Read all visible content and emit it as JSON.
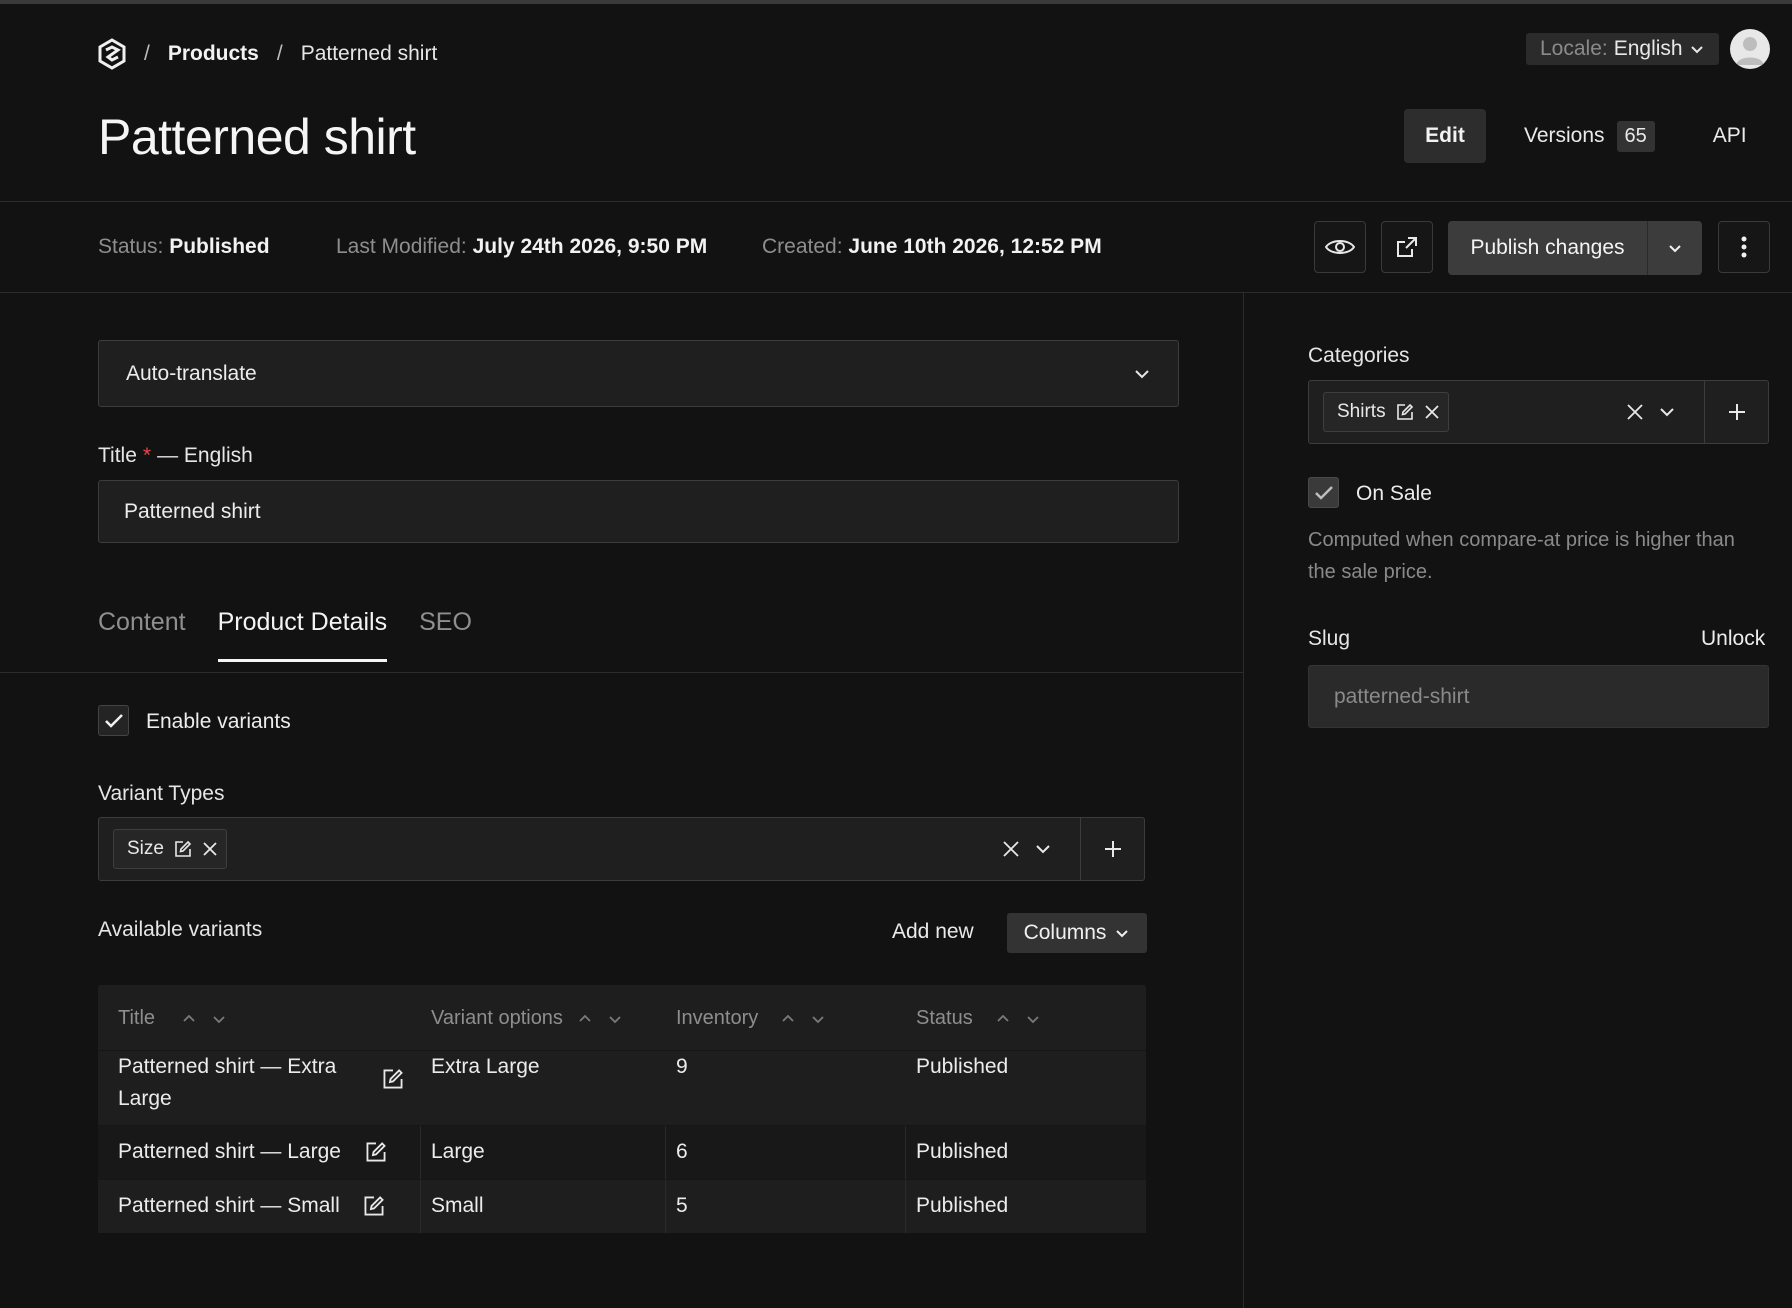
{
  "breadcrumb": {
    "separator": "/",
    "parent": "Products",
    "current": "Patterned shirt"
  },
  "locale": {
    "label": "Locale:",
    "value": "English"
  },
  "page": {
    "title": "Patterned shirt"
  },
  "header_tabs": {
    "edit": "Edit",
    "versions": "Versions",
    "versions_count": "65",
    "api": "API"
  },
  "meta": {
    "status_label": "Status:",
    "status_value": "Published",
    "modified_label": "Last Modified:",
    "modified_value": "July 24th 2026, 9:50 PM",
    "created_label": "Created:",
    "created_value": "June 10th 2026, 12:52 PM"
  },
  "actions": {
    "publish": "Publish changes"
  },
  "form": {
    "auto_translate": "Auto-translate",
    "title_label": "Title",
    "required_mark": "*",
    "title_lang": "— English",
    "title_value": "Patterned shirt"
  },
  "tabs": [
    "Content",
    "Product Details",
    "SEO"
  ],
  "variants": {
    "enable_label": "Enable variants",
    "enabled": true,
    "types_label": "Variant Types",
    "type_chips": [
      "Size"
    ],
    "available_label": "Available variants",
    "add_new": "Add new",
    "columns": "Columns",
    "headers": [
      "Title",
      "Variant options",
      "Inventory",
      "Status"
    ],
    "rows": [
      {
        "title": "Patterned shirt — Extra Large",
        "option": "Extra Large",
        "inventory": "9",
        "status": "Published"
      },
      {
        "title": "Patterned shirt — Large",
        "option": "Large",
        "inventory": "6",
        "status": "Published"
      },
      {
        "title": "Patterned shirt — Small",
        "option": "Small",
        "inventory": "5",
        "status": "Published"
      }
    ]
  },
  "sidebar": {
    "categories_label": "Categories",
    "category_chips": [
      "Shirts"
    ],
    "on_sale_label": "On Sale",
    "on_sale_checked": true,
    "on_sale_help": "Computed when compare-at price is higher than the sale price.",
    "slug_label": "Slug",
    "slug_unlock": "Unlock",
    "slug_value": "patterned-shirt"
  },
  "colors": {
    "background": "#121212",
    "surface": "#1f1f1f",
    "border": "#3c3c3c",
    "text": "#ececec",
    "muted": "#8e8e8e",
    "required": "#e5484d"
  }
}
